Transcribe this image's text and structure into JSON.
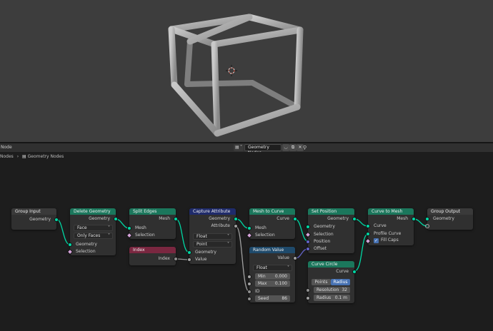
{
  "editor": {
    "header_left": "Node",
    "breadcrumb_prefix": "Nodes",
    "breadcrumb_sep": "›",
    "breadcrumb_tree": "Geometry Nodes",
    "tree_name": "Geometry Nodes",
    "tree_type_icon": "node-tree-icon",
    "chev": "˅"
  },
  "nodes": {
    "group_input": {
      "title": "Group Input",
      "out_geometry": "Geometry"
    },
    "delete_geometry": {
      "title": "Delete Geometry",
      "out_geometry": "Geometry",
      "domain": "Face",
      "mode": "Only Faces",
      "in_geometry": "Geometry",
      "in_selection": "Selection"
    },
    "split_edges": {
      "title": "Split Edges",
      "out_mesh": "Mesh",
      "in_mesh": "Mesh",
      "in_selection": "Selection"
    },
    "index": {
      "title": "Index",
      "out_index": "Index"
    },
    "capture_attribute": {
      "title": "Capture Attribute",
      "out_geometry": "Geometry",
      "out_attribute": "Attribute",
      "data_type": "Float",
      "domain": "Point",
      "in_geometry": "Geometry",
      "in_value": "Value"
    },
    "mesh_to_curve": {
      "title": "Mesh to Curve",
      "out_curve": "Curve",
      "in_mesh": "Mesh",
      "in_selection": "Selection"
    },
    "random_value": {
      "title": "Random Value",
      "out_value": "Value",
      "data_type": "Float",
      "min_label": "Min",
      "min_value": "0.000",
      "max_label": "Max",
      "max_value": "0.100",
      "id_label": "ID",
      "seed_label": "Seed",
      "seed_value": "86"
    },
    "set_position": {
      "title": "Set Position",
      "out_geometry": "Geometry",
      "in_geometry": "Geometry",
      "in_selection": "Selection",
      "in_position": "Position",
      "in_offset": "Offset"
    },
    "curve_circle": {
      "title": "Curve Circle",
      "out_curve": "Curve",
      "mode_points": "Points",
      "mode_radius": "Radius",
      "resolution_label": "Resolution",
      "resolution_value": "32",
      "radius_label": "Radius",
      "radius_value": "0.1 m"
    },
    "curve_to_mesh": {
      "title": "Curve to Mesh",
      "out_mesh": "Mesh",
      "in_curve": "Curve",
      "in_profile": "Profile Curve",
      "fill_caps": "Fill Caps"
    },
    "group_output": {
      "title": "Group Output",
      "in_geometry": "Geometry"
    }
  },
  "colors": {
    "geometry_header": "#1b775c",
    "attribute_header": "#1f2b6b",
    "input_header": "#7a2740",
    "geometry_socket": "#00d6a3",
    "accent": "#4772b3"
  }
}
